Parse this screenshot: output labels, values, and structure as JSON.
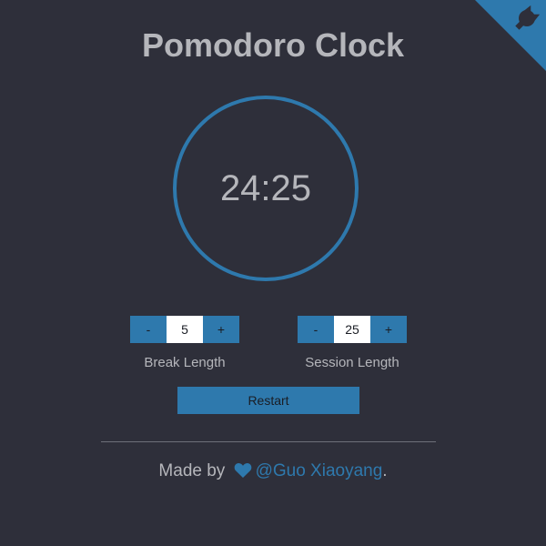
{
  "app": {
    "title": "Pomodoro Clock"
  },
  "timer": {
    "display": "24:25"
  },
  "break": {
    "decrement_label": "-",
    "value": "5",
    "increment_label": "+",
    "label": "Break Length"
  },
  "session": {
    "decrement_label": "-",
    "value": "25",
    "increment_label": "+",
    "label": "Session Length"
  },
  "restart": {
    "label": "Restart"
  },
  "footer": {
    "made_by": "Made by",
    "author": "@Guo Xiaoyang",
    "trailing": "."
  },
  "icons": {
    "corner": "github-corner-icon",
    "heart": "heart-icon"
  },
  "colors": {
    "background": "#2e2f3a",
    "accent": "#2e79ad",
    "text": "#b5b6bb",
    "value_box": "#ffffff"
  }
}
